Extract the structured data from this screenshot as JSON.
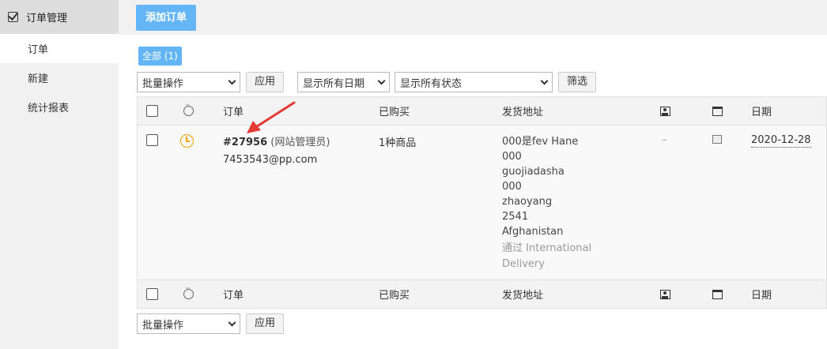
{
  "sidebar": {
    "header": "订单管理",
    "items": [
      {
        "label": "订单",
        "active": true
      },
      {
        "label": "新建",
        "active": false
      },
      {
        "label": "统计报表",
        "active": false
      }
    ]
  },
  "topbar": {
    "add_order_label": "添加订单"
  },
  "filters": {
    "all_label": "全部 (1)"
  },
  "toolbar": {
    "bulk_action": "批量操作",
    "apply_label": "应用",
    "date_filter": "显示所有日期",
    "status_filter": "显示所有状态",
    "filter_label": "筛选"
  },
  "table": {
    "columns": {
      "order": "订单",
      "purchased": "已购买",
      "ship_to": "发货地址",
      "date": "日期"
    },
    "rows": [
      {
        "order_number": "#27956",
        "created_by": "(网站管理员)",
        "email": "7453543@pp.com",
        "purchased": "1种商品",
        "address_lines": [
          "000是fev Hane",
          "000",
          "guojiadasha",
          "000",
          "zhaoyang",
          "2541",
          "Afghanistan"
        ],
        "shipping_method_1": "通过 International",
        "shipping_method_2": "Delivery",
        "customer": "–",
        "date": "2020-12-28"
      }
    ]
  },
  "bottom_toolbar": {
    "bulk_action": "批量操作",
    "apply_label": "应用"
  },
  "colors": {
    "accent": "#64b5f6",
    "pending": "#f0a000",
    "annotation_arrow": "#e53935"
  }
}
